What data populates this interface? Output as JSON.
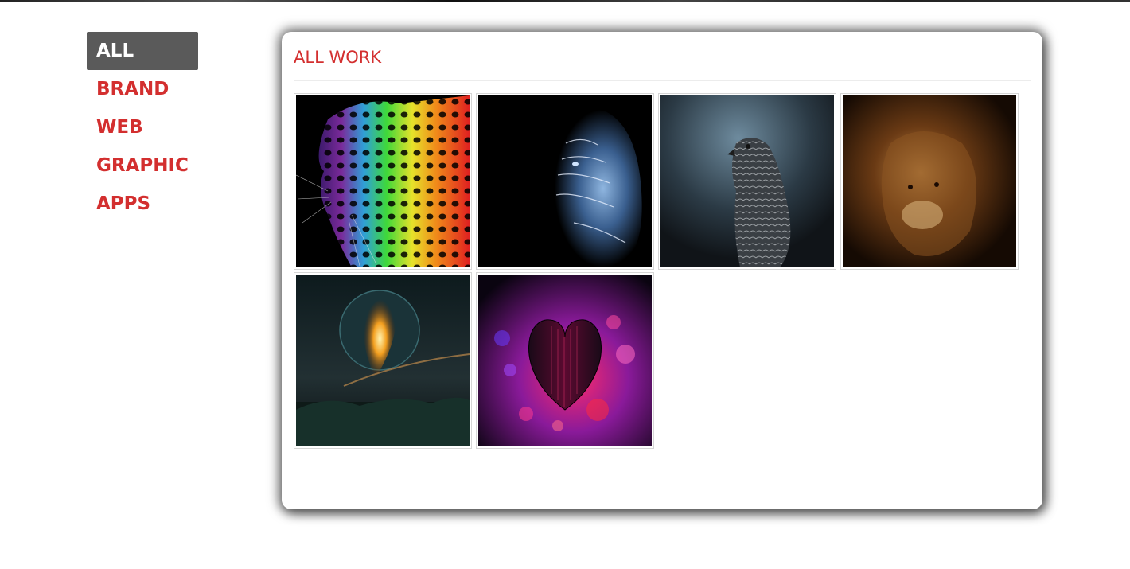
{
  "nav": {
    "items": [
      {
        "label": "ALL",
        "active": true
      },
      {
        "label": "BRAND",
        "active": false
      },
      {
        "label": "WEB",
        "active": false
      },
      {
        "label": "GRAPHIC",
        "active": false
      },
      {
        "label": "APPS",
        "active": false
      }
    ]
  },
  "panel": {
    "title": "ALL WORK"
  },
  "gallery": {
    "items": [
      {
        "subject": "rainbow-leopard"
      },
      {
        "subject": "glowing-tiger"
      },
      {
        "subject": "hawk"
      },
      {
        "subject": "lion"
      },
      {
        "subject": "glowing-heart-planet"
      },
      {
        "subject": "heart-bokeh"
      }
    ]
  },
  "colors": {
    "accent": "#d32f2f",
    "active_nav_bg": "#5a5a5a",
    "active_nav_text": "#ffffff"
  }
}
